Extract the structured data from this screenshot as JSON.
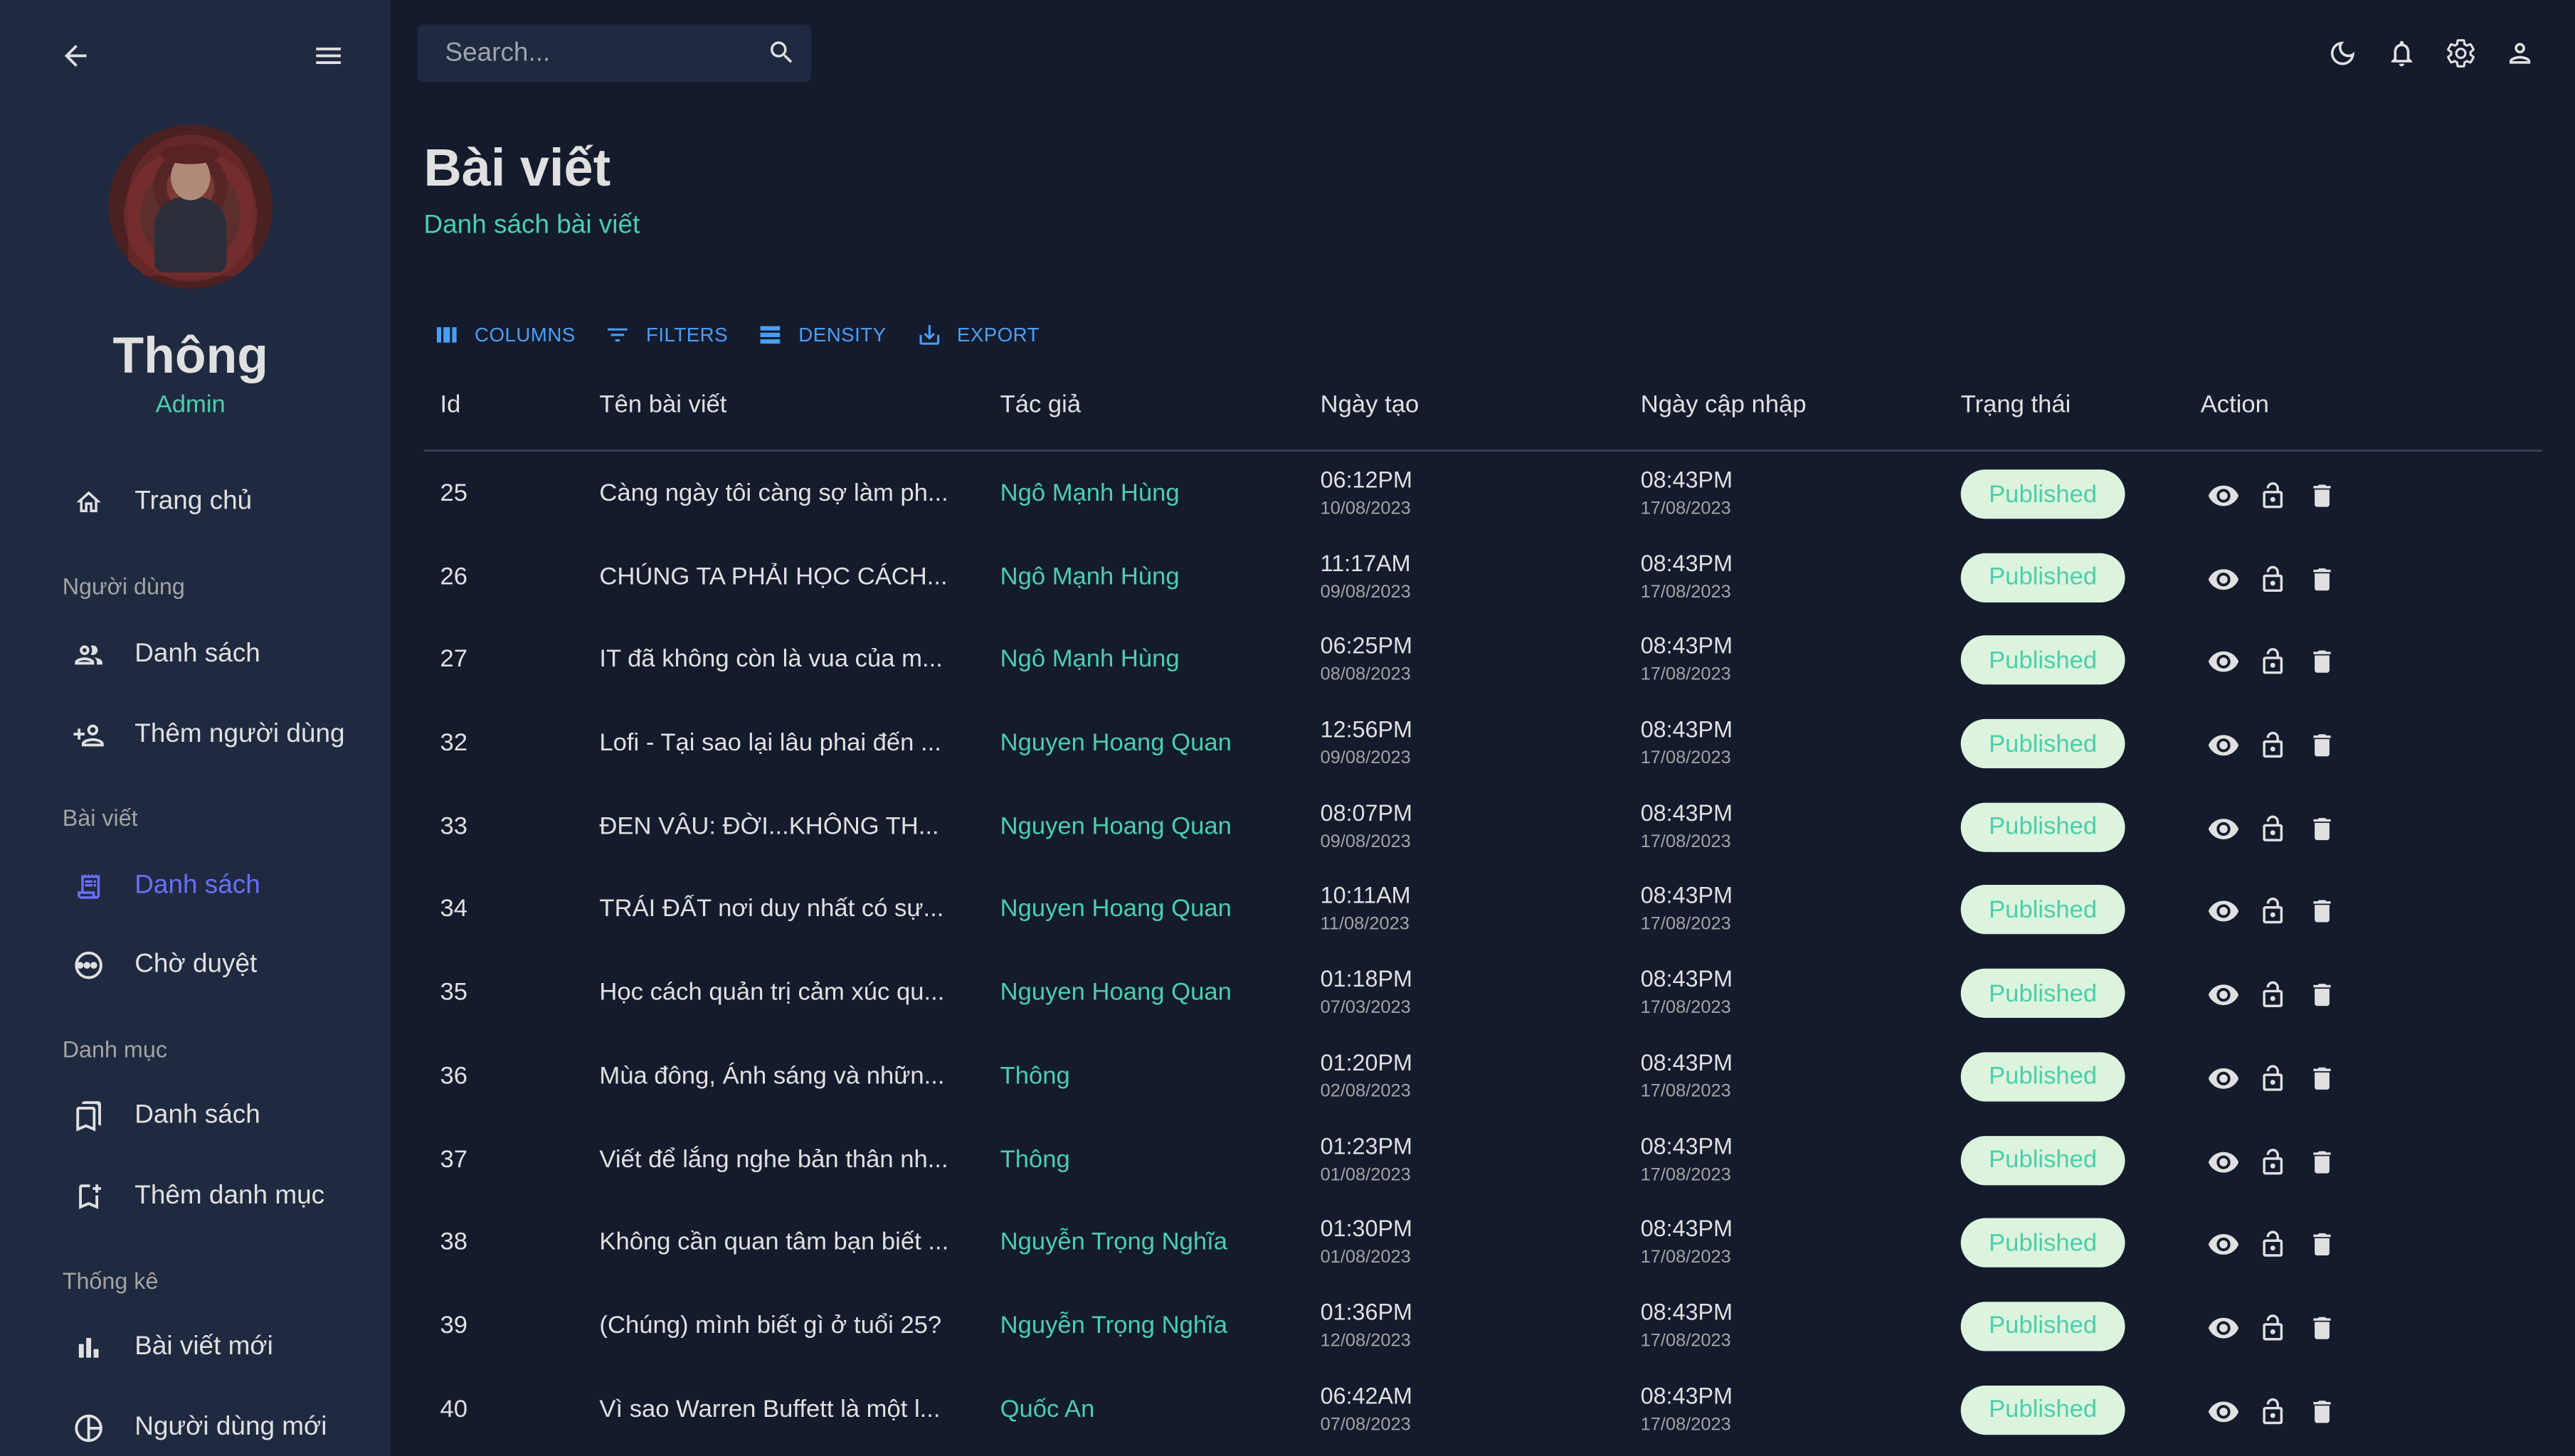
{
  "sidebar": {
    "profile": {
      "name": "Thông",
      "role": "Admin"
    },
    "items": [
      {
        "label": "Trang chủ",
        "icon": "home-icon"
      },
      {
        "section": "Người dùng"
      },
      {
        "label": "Danh sách",
        "icon": "people-icon"
      },
      {
        "label": "Thêm người dùng",
        "icon": "person-add-icon"
      },
      {
        "section": "Bài viết"
      },
      {
        "label": "Danh sách",
        "icon": "receipt-icon",
        "active": true
      },
      {
        "label": "Chờ duyệt",
        "icon": "pending-icon"
      },
      {
        "section": "Danh mục"
      },
      {
        "label": "Danh sách",
        "icon": "bookmarks-icon"
      },
      {
        "label": "Thêm danh mục",
        "icon": "bookmark-add-icon"
      },
      {
        "section": "Thống kê"
      },
      {
        "label": "Bài viết mới",
        "icon": "bar-chart-icon"
      },
      {
        "label": "Người dùng mới",
        "icon": "pie-chart-icon"
      }
    ]
  },
  "topbar": {
    "search_placeholder": "Search...",
    "icons": [
      "dark-mode-icon",
      "notifications-icon",
      "settings-icon",
      "person-icon"
    ]
  },
  "page": {
    "title": "Bài viết",
    "subtitle": "Danh sách bài viết"
  },
  "toolbar": {
    "columns": "COLUMNS",
    "filters": "FILTERS",
    "density": "DENSITY",
    "export": "EXPORT"
  },
  "table": {
    "headers": {
      "id": "Id",
      "title": "Tên bài viết",
      "author": "Tác giả",
      "created": "Ngày tạo",
      "updated": "Ngày cập nhập",
      "status": "Trạng thái",
      "action": "Action"
    },
    "rows": [
      {
        "id": "25",
        "title": "Càng ngày tôi càng sợ làm ph...",
        "author": "Ngô Mạnh Hùng",
        "created_time": "06:12PM",
        "created_date": "10/08/2023",
        "updated_time": "08:43PM",
        "updated_date": "17/08/2023",
        "status": "Published"
      },
      {
        "id": "26",
        "title": "CHÚNG TA PHẢI HỌC CÁCH...",
        "author": "Ngô Mạnh Hùng",
        "created_time": "11:17AM",
        "created_date": "09/08/2023",
        "updated_time": "08:43PM",
        "updated_date": "17/08/2023",
        "status": "Published"
      },
      {
        "id": "27",
        "title": "IT đã không còn là vua của m...",
        "author": "Ngô Mạnh Hùng",
        "created_time": "06:25PM",
        "created_date": "08/08/2023",
        "updated_time": "08:43PM",
        "updated_date": "17/08/2023",
        "status": "Published"
      },
      {
        "id": "32",
        "title": "Lofi - Tại sao lại lâu phai đến ...",
        "author": "Nguyen Hoang Quan",
        "created_time": "12:56PM",
        "created_date": "09/08/2023",
        "updated_time": "08:43PM",
        "updated_date": "17/08/2023",
        "status": "Published"
      },
      {
        "id": "33",
        "title": "ĐEN VÂU: ĐỜI...KHÔNG TH...",
        "author": "Nguyen Hoang Quan",
        "created_time": "08:07PM",
        "created_date": "09/08/2023",
        "updated_time": "08:43PM",
        "updated_date": "17/08/2023",
        "status": "Published"
      },
      {
        "id": "34",
        "title": "TRÁI ĐẤT nơi duy nhất có sự...",
        "author": "Nguyen Hoang Quan",
        "created_time": "10:11AM",
        "created_date": "11/08/2023",
        "updated_time": "08:43PM",
        "updated_date": "17/08/2023",
        "status": "Published"
      },
      {
        "id": "35",
        "title": "Học cách quản trị cảm xúc qu...",
        "author": "Nguyen Hoang Quan",
        "created_time": "01:18PM",
        "created_date": "07/03/2023",
        "updated_time": "08:43PM",
        "updated_date": "17/08/2023",
        "status": "Published"
      },
      {
        "id": "36",
        "title": "Mùa đông, Ánh sáng và nhữn...",
        "author": "Thông",
        "created_time": "01:20PM",
        "created_date": "02/08/2023",
        "updated_time": "08:43PM",
        "updated_date": "17/08/2023",
        "status": "Published"
      },
      {
        "id": "37",
        "title": "Viết để lắng nghe bản thân nh...",
        "author": "Thông",
        "created_time": "01:23PM",
        "created_date": "01/08/2023",
        "updated_time": "08:43PM",
        "updated_date": "17/08/2023",
        "status": "Published"
      },
      {
        "id": "38",
        "title": "Không cần quan tâm bạn biết ...",
        "author": "Nguyễn Trọng Nghĩa",
        "created_time": "01:30PM",
        "created_date": "01/08/2023",
        "updated_time": "08:43PM",
        "updated_date": "17/08/2023",
        "status": "Published"
      },
      {
        "id": "39",
        "title": "(Chúng) mình biết gì ở tuổi 25?",
        "author": "Nguyễn Trọng Nghĩa",
        "created_time": "01:36PM",
        "created_date": "12/08/2023",
        "updated_time": "08:43PM",
        "updated_date": "17/08/2023",
        "status": "Published"
      },
      {
        "id": "40",
        "title": "Vì sao Warren Buffett là một l...",
        "author": "Quốc An",
        "created_time": "06:42AM",
        "created_date": "07/08/2023",
        "updated_time": "08:43PM",
        "updated_date": "17/08/2023",
        "status": "Published"
      }
    ]
  },
  "colors": {
    "background": "#141b2d",
    "panel": "#1f2a40",
    "accent_green": "#4cceac",
    "accent_blue": "#6870fa",
    "toolbar_blue": "#4a9ff5",
    "badge_bg": "#dcf4dd"
  }
}
